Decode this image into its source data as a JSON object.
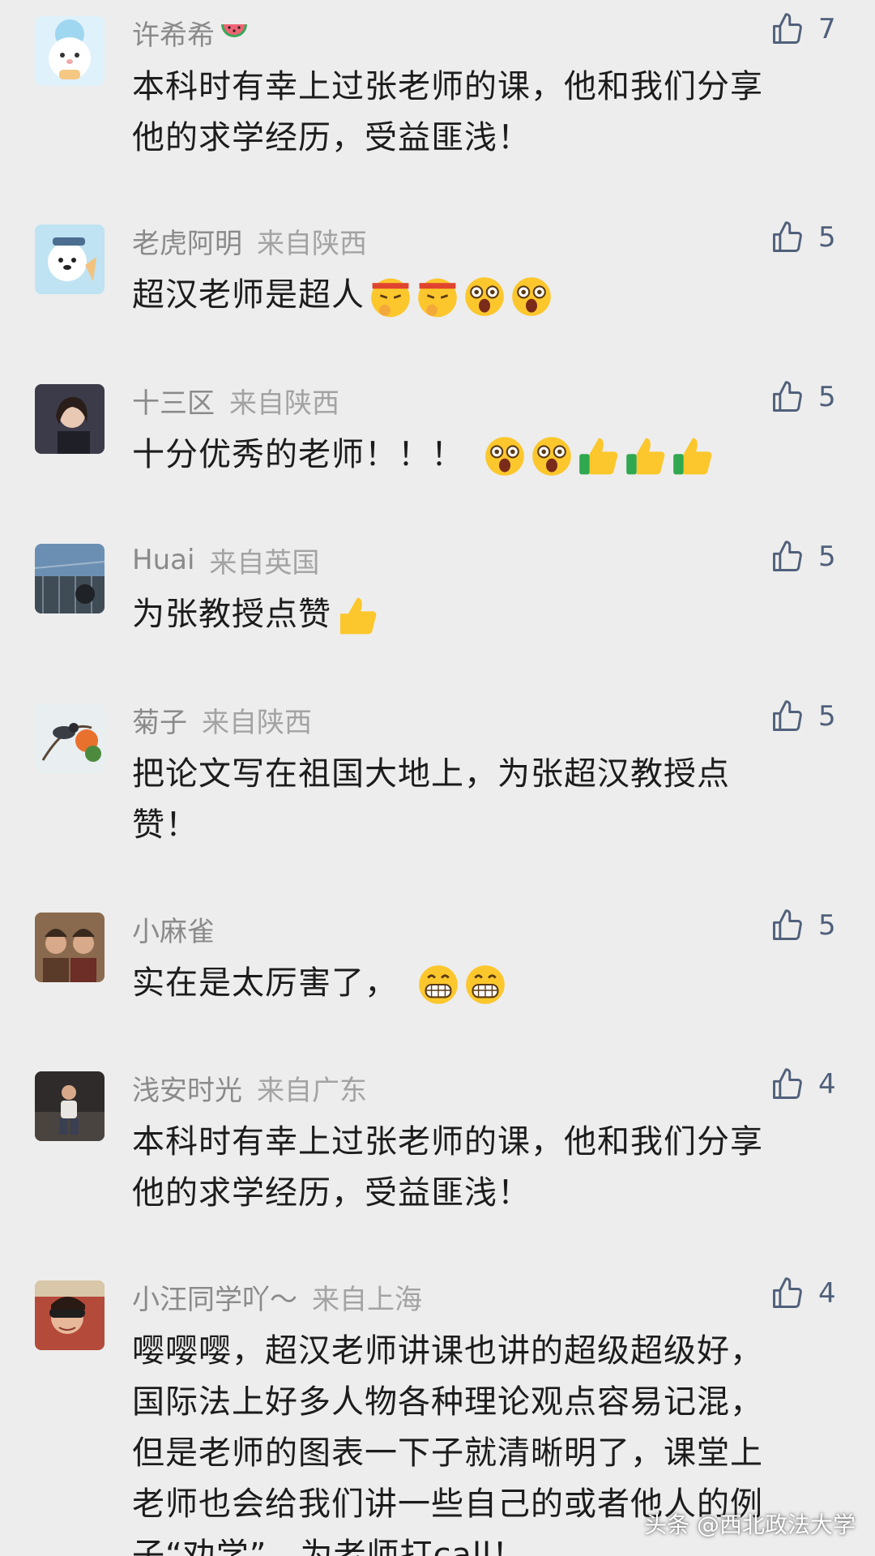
{
  "comments": [
    {
      "username": "许希希",
      "username_emoji": "watermelon-emoji",
      "location": "",
      "likes": "7",
      "text_lines": [
        "本科时有幸上过张老师的课，他和我们分享",
        "他的求学经历，受益匪浅！"
      ]
    },
    {
      "username": "老虎阿明",
      "location": "来自陕西",
      "likes": "5",
      "text_lines": [
        "超汉老师是超人"
      ],
      "emojis": [
        "fighting-face-emoji",
        "fighting-face-emoji",
        "amazed-face-emoji",
        "amazed-face-emoji"
      ]
    },
    {
      "username": "十三区",
      "location": "来自陕西",
      "likes": "5",
      "text_lines": [
        "十分优秀的老师！！！"
      ],
      "emojis": [
        "amazed-face-emoji",
        "amazed-face-emoji",
        "thumbs-up-emoji",
        "thumbs-up-emoji",
        "thumbs-up-emoji"
      ]
    },
    {
      "username": "Huai",
      "location": "来自英国",
      "likes": "5",
      "text_lines": [
        "为张教授点赞"
      ],
      "emojis": [
        "thumbs-up-emoji"
      ]
    },
    {
      "username": "菊子",
      "location": "来自陕西",
      "likes": "5",
      "text_lines": [
        "把论文写在祖国大地上，为张超汉教授点",
        "赞！"
      ]
    },
    {
      "username": "小麻雀",
      "location": "",
      "likes": "5",
      "text_lines": [
        "实在是太厉害了，"
      ],
      "emojis": [
        "grinning-face-emoji",
        "grinning-face-emoji"
      ]
    },
    {
      "username": "浅安时光",
      "location": "来自广东",
      "likes": "4",
      "text_lines": [
        "本科时有幸上过张老师的课，他和我们分享",
        "他的求学经历，受益匪浅！"
      ]
    },
    {
      "username": "小汪同学吖～",
      "location": "来自上海",
      "likes": "4",
      "text_lines": [
        "嘤嘤嘤，超汉老师讲课也讲的超级超级好，",
        "国际法上好多人物各种理论观点容易记混，",
        "但是老师的图表一下子就清晰明了，课堂上",
        "老师也会给我们讲一些自己的或者他人的例",
        "子“劝学”，为老师打call！"
      ]
    }
  ],
  "watermark": "头条 @西北政法大学",
  "colors": {
    "background": "#ededed",
    "username": "#8a8a8a",
    "location": "#a3a3a3",
    "like_icon": "#50607a",
    "text": "#1c1c1c"
  }
}
